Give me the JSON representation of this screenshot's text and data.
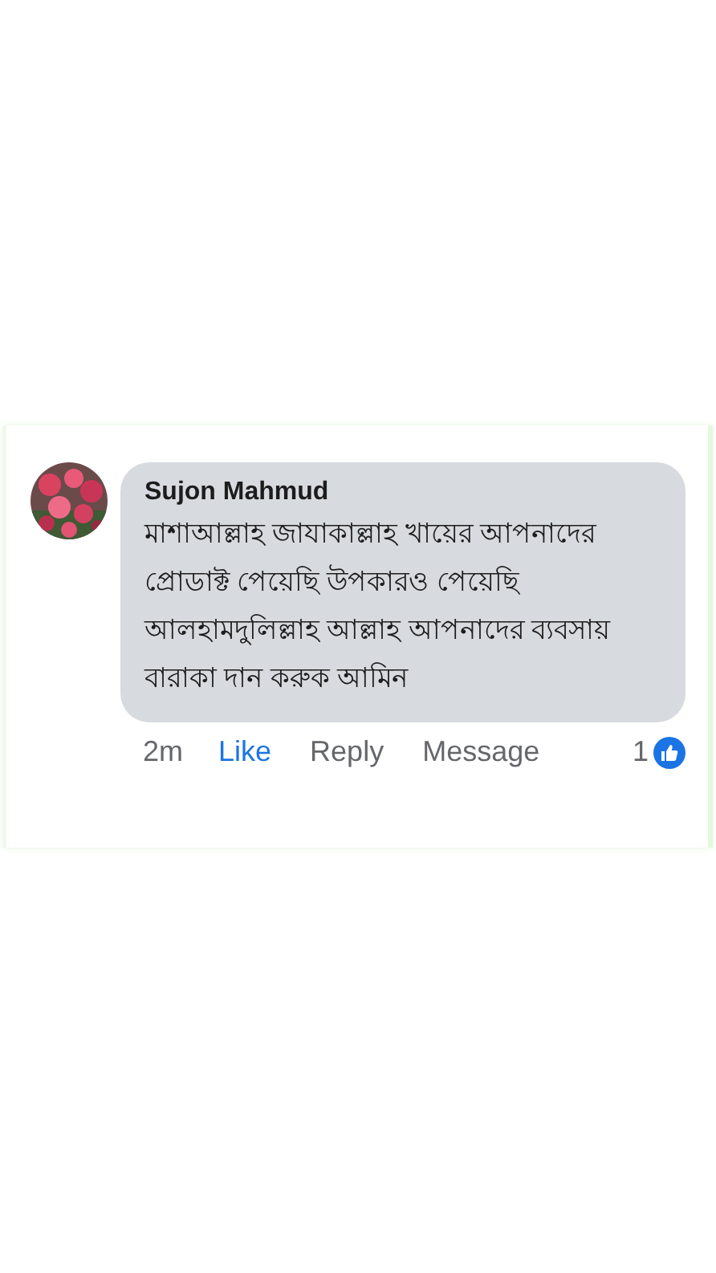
{
  "comment": {
    "author": "Sujon Mahmud",
    "text": "মাশাআল্লাহ জাযাকাল্লাহ খায়ের আপনাদের প্রোডাক্ট পেয়েছি উপকারও পেয়েছি আলহামদুলিল্লাহ আল্লাহ আপনাদের ব্যবসায় বারাকা দান করুক আমিন",
    "time": "2m",
    "actions": [
      {
        "label": "Like",
        "selected": true
      },
      {
        "label": "Reply",
        "selected": false
      },
      {
        "label": "Message",
        "selected": false
      }
    ],
    "reaction_count": "1"
  }
}
